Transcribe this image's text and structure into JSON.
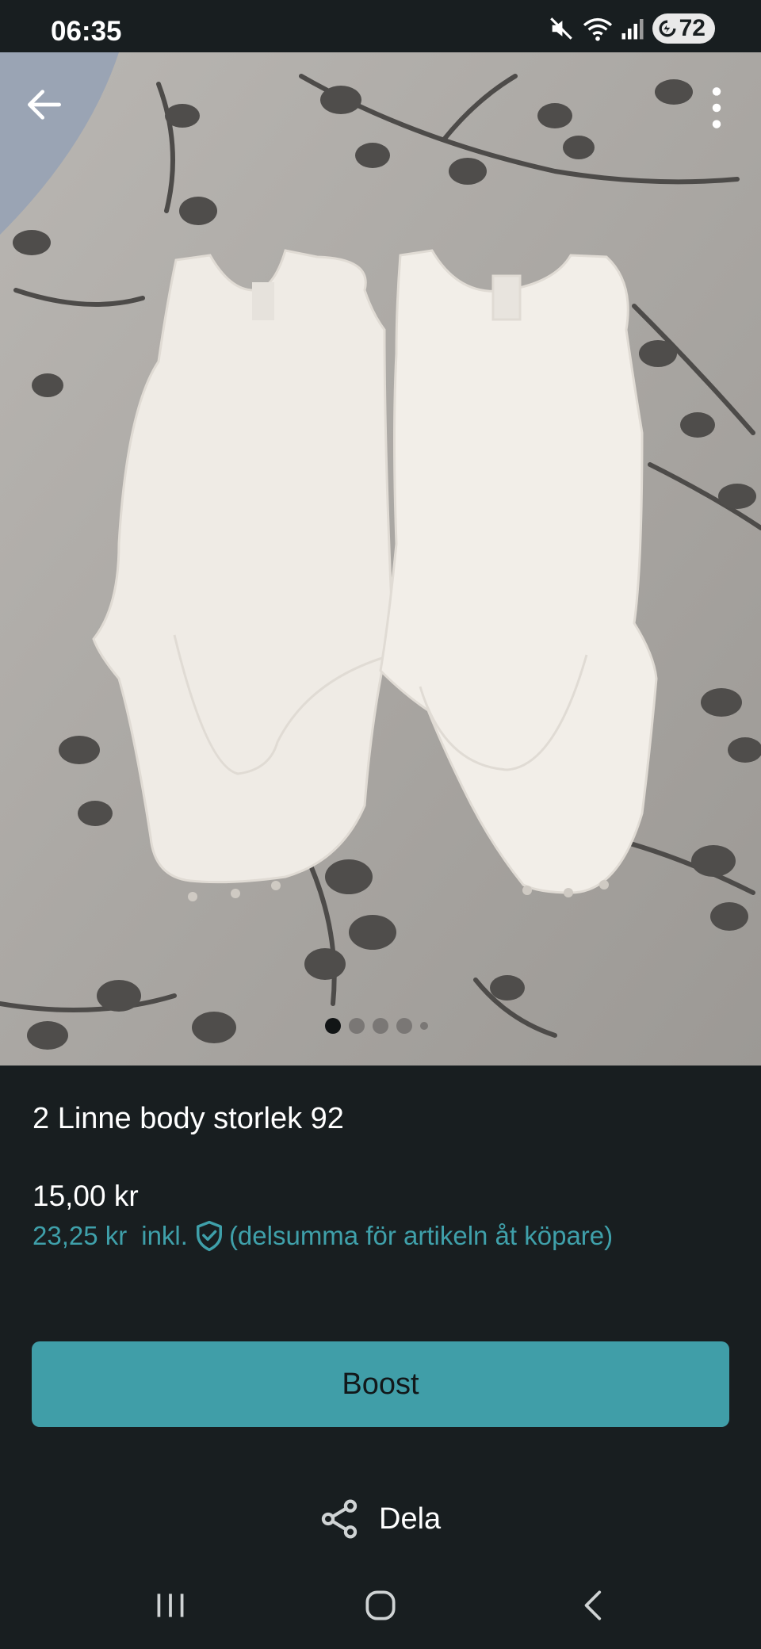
{
  "status_bar": {
    "time": "06:35",
    "battery": "72"
  },
  "product": {
    "title": "2 Linne body storlek 92",
    "price": "15,00 kr",
    "price_incl_amount": "23,25 kr",
    "price_incl_label": "inkl.",
    "price_incl_note": "(delsumma för artikeln åt köpare)"
  },
  "carousel": {
    "page_count": 5,
    "current_page": 1
  },
  "actions": {
    "boost_label": "Boost",
    "share_label": "Dela"
  },
  "colors": {
    "background": "#181e20",
    "accent": "#409ea8",
    "accent_text": "#3fa0aa"
  },
  "icons": [
    "back-arrow-icon",
    "more-vert-icon",
    "shield-check-icon",
    "share-icon",
    "mute-icon",
    "wifi-icon",
    "signal-icon",
    "recents-icon",
    "home-icon",
    "nav-back-icon"
  ]
}
